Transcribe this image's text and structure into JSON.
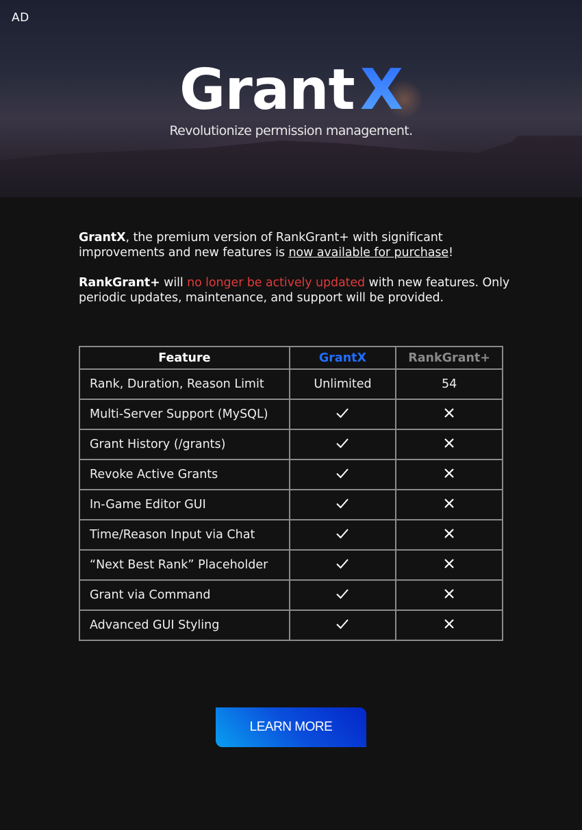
{
  "hero": {
    "ad_label": "AD",
    "logo_main": "Grant",
    "logo_accent": "X",
    "tagline": "Revolutionize permission management."
  },
  "intro": {
    "p1_bold": "GrantX",
    "p1_text": ", the premium version of RankGrant+ with significant improvements and new features is ",
    "p1_link": "now available for purchase",
    "p1_end": "!",
    "p2_bold": "RankGrant+",
    "p2_text": " will ",
    "p2_red": "no longer be actively updated",
    "p2_rest": " with new features. Only periodic updates, maintenance, and support will be provided.",
    "colors": {
      "warning": "#e03a3a"
    }
  },
  "table": {
    "headers": [
      "Feature",
      "GrantX",
      "RankGrant+"
    ],
    "header_colors": {
      "grantx": "#1f6fff",
      "rankgrant": "#8a8a8a"
    },
    "rows": [
      {
        "feature": "Rank, Duration, Reason Limit",
        "grantx": "Unlimited",
        "rankgrant": "54"
      },
      {
        "feature": "Multi-Server Support (MySQL)",
        "grantx": "check-icon",
        "rankgrant": "cross-icon"
      },
      {
        "feature": "Grant History (/grants)",
        "grantx": "check-icon",
        "rankgrant": "cross-icon"
      },
      {
        "feature": "Revoke Active Grants",
        "grantx": "check-icon",
        "rankgrant": "cross-icon"
      },
      {
        "feature": "In-Game Editor GUI",
        "grantx": "check-icon",
        "rankgrant": "cross-icon"
      },
      {
        "feature": "Time/Reason Input via Chat",
        "grantx": "check-icon",
        "rankgrant": "cross-icon"
      },
      {
        "feature": "“Next Best Rank” Placeholder",
        "grantx": "check-icon",
        "rankgrant": "cross-icon"
      },
      {
        "feature": "Grant via Command",
        "grantx": "check-icon",
        "rankgrant": "cross-icon"
      },
      {
        "feature": "Advanced GUI Styling",
        "grantx": "check-icon",
        "rankgrant": "cross-icon"
      }
    ]
  },
  "cta": {
    "label": "LEARN MORE"
  }
}
